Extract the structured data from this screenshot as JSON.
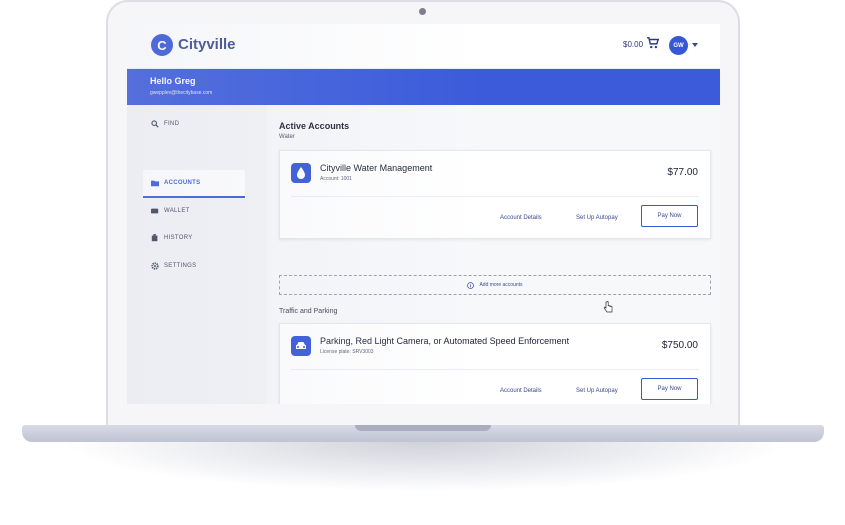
{
  "app": {
    "logo_letter": "C",
    "name": "Cityville"
  },
  "header": {
    "cart_total": "$0.00",
    "avatar_initials": "GW"
  },
  "banner": {
    "greeting": "Hello Greg",
    "email": "gwepplev@thecitybase.com"
  },
  "sidebar": {
    "items": [
      {
        "label": "FIND",
        "icon": "search-icon",
        "active": false
      },
      {
        "label": "ACCOUNTS",
        "icon": "folder-icon",
        "active": true
      },
      {
        "label": "WALLET",
        "icon": "wallet-icon",
        "active": false
      },
      {
        "label": "HISTORY",
        "icon": "history-icon",
        "active": false
      },
      {
        "label": "SETTINGS",
        "icon": "gear-icon",
        "active": false
      }
    ]
  },
  "main": {
    "title": "Active Accounts",
    "water_label": "Water",
    "traffic_label": "Traffic and Parking",
    "add_more": "Add more accounts",
    "accounts": [
      {
        "name": "Cityville Water Management",
        "meta": "Account: 1001",
        "amount": "$77.00",
        "icon": "water-drop-icon",
        "details": "Account Details",
        "autopay": "Set Up Autopay",
        "pay": "Pay Now"
      },
      {
        "name": "Parking, Red Light Camera, or Automated Speed Enforcement",
        "meta": "License plate: SRV3003",
        "amount": "$750.00",
        "icon": "car-icon",
        "details": "Account Details",
        "autopay": "Set Up Autopay",
        "pay": "Pay Now"
      }
    ]
  },
  "colors": {
    "brand": "#3b5bdb",
    "text": "#1d2133"
  }
}
